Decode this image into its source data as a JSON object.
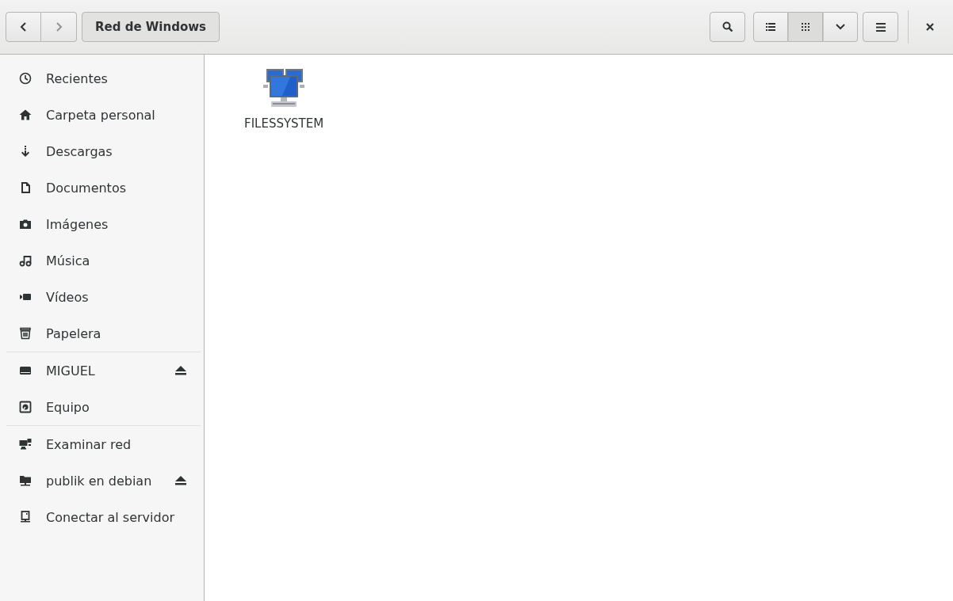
{
  "header": {
    "back": {
      "disabled": false
    },
    "forward": {
      "disabled": true
    },
    "path": "Red de Windows",
    "views": [
      {
        "kind": "list",
        "selected": false
      },
      {
        "kind": "grid",
        "selected": true
      }
    ]
  },
  "sidebar": {
    "groups": [
      {
        "items": [
          {
            "kind": "recent",
            "label": "Recientes",
            "ejectable": false
          },
          {
            "kind": "home",
            "label": "Carpeta personal",
            "ejectable": false
          },
          {
            "kind": "download",
            "label": "Descargas",
            "ejectable": false
          },
          {
            "kind": "document",
            "label": "Documentos",
            "ejectable": false
          },
          {
            "kind": "camera",
            "label": "Imágenes",
            "ejectable": false
          },
          {
            "kind": "music",
            "label": "Música",
            "ejectable": false
          },
          {
            "kind": "video",
            "label": "Vídeos",
            "ejectable": false
          },
          {
            "kind": "trash",
            "label": "Papelera",
            "ejectable": false
          }
        ]
      },
      {
        "items": [
          {
            "kind": "drive",
            "label": "MIGUEL",
            "ejectable": true
          },
          {
            "kind": "disk",
            "label": "Equipo",
            "ejectable": false
          }
        ]
      },
      {
        "items": [
          {
            "kind": "network",
            "label": "Examinar red",
            "ejectable": false
          },
          {
            "kind": "share",
            "label": "publik en debian",
            "ejectable": true
          },
          {
            "kind": "server",
            "label": "Conectar al servidor",
            "ejectable": false
          }
        ]
      }
    ]
  },
  "files": [
    {
      "name": "FILESSYSTEM"
    }
  ]
}
